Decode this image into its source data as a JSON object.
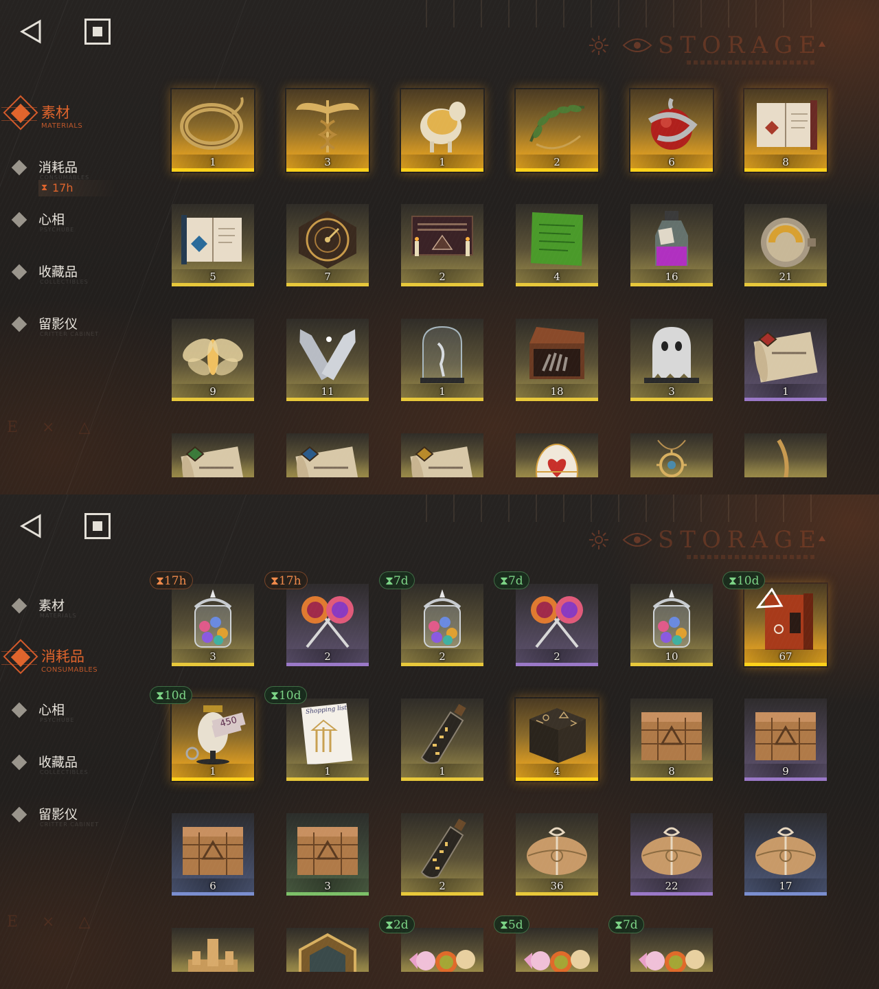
{
  "storage_title": "STORAGE",
  "side_mark": "E × △",
  "panels": [
    {
      "id": "materials-view",
      "nav": [
        {
          "label": "素材",
          "sub": "MATERIALS",
          "active": true
        },
        {
          "label": "消耗品",
          "sub": "CONSUMABLES",
          "active": false
        },
        {
          "label": "心相",
          "sub": "PSYCHUBE",
          "active": false
        },
        {
          "label": "收藏品",
          "sub": "COLLECTIBLES",
          "active": false
        },
        {
          "label": "留影仪",
          "sub": "CRITTER CABINET",
          "active": false
        }
      ],
      "consumables_timer": "17h",
      "items": [
        {
          "count": "1",
          "rarity": "gold",
          "icon": "bracelet-icon"
        },
        {
          "count": "3",
          "rarity": "gold",
          "icon": "caduceus-icon"
        },
        {
          "count": "1",
          "rarity": "gold",
          "icon": "golden-sheep-icon"
        },
        {
          "count": "2",
          "rarity": "gold",
          "icon": "laurel-wreath-icon"
        },
        {
          "count": "6",
          "rarity": "gold",
          "icon": "apple-serpent-icon"
        },
        {
          "count": "8",
          "rarity": "gold",
          "icon": "red-spellbook-icon"
        },
        {
          "count": "5",
          "rarity": "olive",
          "icon": "blue-spellbook-icon"
        },
        {
          "count": "7",
          "rarity": "olive",
          "icon": "astrolabe-icon"
        },
        {
          "count": "2",
          "rarity": "olive",
          "icon": "ouija-board-icon"
        },
        {
          "count": "4",
          "rarity": "olive",
          "icon": "green-tablet-icon"
        },
        {
          "count": "16",
          "rarity": "olive",
          "icon": "potion-bottle-icon"
        },
        {
          "count": "21",
          "rarity": "olive",
          "icon": "stopwatch-icon"
        },
        {
          "count": "9",
          "rarity": "olive",
          "icon": "glowing-moth-icon"
        },
        {
          "count": "11",
          "rarity": "olive",
          "icon": "silver-bullets-icon"
        },
        {
          "count": "1",
          "rarity": "olive",
          "icon": "bell-jar-icon"
        },
        {
          "count": "18",
          "rarity": "olive",
          "icon": "treasure-chest-hand-icon"
        },
        {
          "count": "3",
          "rarity": "olive",
          "icon": "ghost-sheet-icon"
        },
        {
          "count": "1",
          "rarity": "purple",
          "icon": "scroll-red-seal-icon"
        },
        {
          "count": "",
          "rarity": "olive",
          "icon": "scroll-green-seal-icon"
        },
        {
          "count": "",
          "rarity": "olive",
          "icon": "scroll-blue-seal-icon"
        },
        {
          "count": "",
          "rarity": "olive",
          "icon": "scroll-gold-seal-icon"
        },
        {
          "count": "",
          "rarity": "olive",
          "icon": "jeweled-egg-icon"
        },
        {
          "count": "",
          "rarity": "olive",
          "icon": "amulet-necklace-icon"
        },
        {
          "count": "",
          "rarity": "olive",
          "icon": "chain-ornament-icon"
        }
      ]
    },
    {
      "id": "consumables-view",
      "nav": [
        {
          "label": "素材",
          "sub": "MATERIALS",
          "active": false
        },
        {
          "label": "消耗品",
          "sub": "CONSUMABLES",
          "active": true
        },
        {
          "label": "心相",
          "sub": "PSYCHUBE",
          "active": false
        },
        {
          "label": "收藏品",
          "sub": "COLLECTIBLES",
          "active": false
        },
        {
          "label": "留影仪",
          "sub": "CRITTER CABINET",
          "active": false
        }
      ],
      "items": [
        {
          "count": "3",
          "rarity": "olive",
          "icon": "candy-jar-icon",
          "timer": "17h",
          "timer_color": "orange"
        },
        {
          "count": "2",
          "rarity": "purple",
          "icon": "lollipops-icon",
          "timer": "17h",
          "timer_color": "orange"
        },
        {
          "count": "2",
          "rarity": "olive",
          "icon": "candy-jar-icon",
          "timer": "7d",
          "timer_color": "green"
        },
        {
          "count": "2",
          "rarity": "purple",
          "icon": "lollipops-icon",
          "timer": "7d",
          "timer_color": "green"
        },
        {
          "count": "10",
          "rarity": "olive",
          "icon": "candy-jar-icon",
          "timer": "",
          "timer_color": ""
        },
        {
          "count": "67",
          "rarity": "gold",
          "icon": "rune-book-icon",
          "timer": "10d",
          "timer_color": "green"
        },
        {
          "count": "1",
          "rarity": "gold",
          "icon": "mannequin-icon",
          "timer": "10d",
          "timer_color": "green",
          "price_tag": "450"
        },
        {
          "count": "1",
          "rarity": "olive",
          "icon": "shopping-list-icon",
          "timer": "10d",
          "timer_color": "green",
          "list_title": "Shopping list"
        },
        {
          "count": "1",
          "rarity": "olive",
          "icon": "message-bottle-icon",
          "timer": "",
          "timer_color": ""
        },
        {
          "count": "4",
          "rarity": "gold",
          "icon": "rune-cube-icon",
          "timer": "",
          "timer_color": ""
        },
        {
          "count": "8",
          "rarity": "olive",
          "icon": "wooden-crate-icon",
          "timer": "",
          "timer_color": ""
        },
        {
          "count": "9",
          "rarity": "purple",
          "icon": "wooden-crate-icon",
          "timer": "",
          "timer_color": ""
        },
        {
          "count": "6",
          "rarity": "blue",
          "icon": "wooden-crate-icon",
          "timer": "",
          "timer_color": ""
        },
        {
          "count": "3",
          "rarity": "green",
          "icon": "wooden-crate-icon",
          "timer": "",
          "timer_color": ""
        },
        {
          "count": "2",
          "rarity": "olive",
          "icon": "message-bottle-icon",
          "timer": "",
          "timer_color": ""
        },
        {
          "count": "36",
          "rarity": "olive",
          "icon": "paper-parcel-icon",
          "timer": "",
          "timer_color": ""
        },
        {
          "count": "22",
          "rarity": "purple",
          "icon": "paper-parcel-icon",
          "timer": "",
          "timer_color": ""
        },
        {
          "count": "17",
          "rarity": "blue",
          "icon": "paper-parcel-icon",
          "timer": "",
          "timer_color": ""
        },
        {
          "count": "",
          "rarity": "olive",
          "icon": "sand-castle-icon",
          "timer": "",
          "timer_color": ""
        },
        {
          "count": "",
          "rarity": "olive",
          "icon": "hex-emblem-icon",
          "timer": "",
          "timer_color": ""
        },
        {
          "count": "",
          "rarity": "olive",
          "icon": "wrapped-candies-icon",
          "timer": "2d",
          "timer_color": "green"
        },
        {
          "count": "",
          "rarity": "olive",
          "icon": "wrapped-candies-icon",
          "timer": "5d",
          "timer_color": "green"
        },
        {
          "count": "",
          "rarity": "olive",
          "icon": "wrapped-candies-icon",
          "timer": "7d",
          "timer_color": "green"
        }
      ]
    }
  ],
  "timer_glyph": "⧗"
}
